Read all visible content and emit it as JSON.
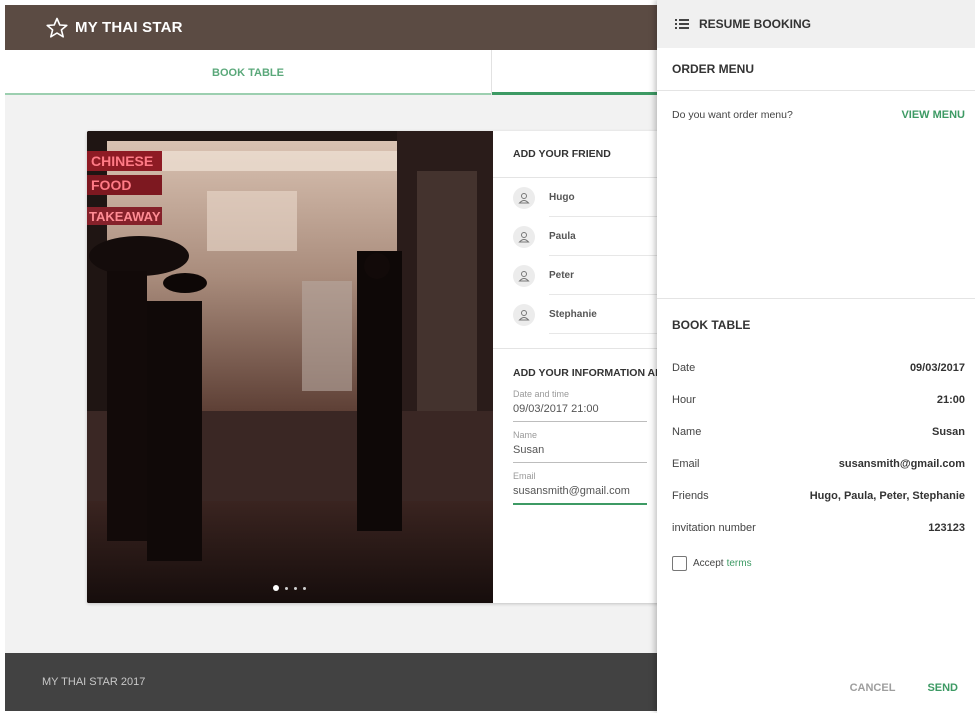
{
  "header": {
    "title": "MY THAI STAR",
    "logo_icon": "star-outline-icon"
  },
  "tabs": [
    {
      "label": "BOOK TABLE"
    },
    {
      "label": ""
    }
  ],
  "friends": {
    "heading": "ADD YOUR FRIEND",
    "items": [
      {
        "name": "Hugo"
      },
      {
        "name": "Paula"
      },
      {
        "name": "Peter"
      },
      {
        "name": "Stephanie"
      }
    ]
  },
  "info": {
    "heading": "ADD YOUR INFORMATION AI",
    "date_label": "Date and time",
    "date_value": "09/03/2017  21:00",
    "name_label": "Name",
    "name_value": "Susan",
    "email_label": "Email",
    "email_value": "susansmith@gmail.com"
  },
  "carousel": {
    "slides": 4,
    "active": 1
  },
  "footer": {
    "text": "MY THAI STAR 2017"
  },
  "panel": {
    "title": "RESUME BOOKING",
    "menu_icon": "list-menu-icon",
    "order": {
      "title": "ORDER MENU",
      "question": "Do you want order menu?",
      "view_label": "VIEW MENU"
    },
    "book": {
      "title": "BOOK TABLE",
      "rows": [
        {
          "label": "Date",
          "value": "09/03/2017"
        },
        {
          "label": "Hour",
          "value": "21:00"
        },
        {
          "label": "Name",
          "value": "Susan"
        },
        {
          "label": "Email",
          "value": "susansmith@gmail.com"
        },
        {
          "label": "Friends",
          "value": "Hugo, Paula, Peter, Stephanie"
        },
        {
          "label": "invitation number",
          "value": "123123"
        }
      ],
      "accept_text": "Accept",
      "terms_label": "terms"
    },
    "cancel_label": "CANCEL",
    "send_label": "SEND"
  },
  "colors": {
    "header_bg": "#5b4b43",
    "accent": "#3d9a64",
    "footer_bg": "#424242"
  }
}
